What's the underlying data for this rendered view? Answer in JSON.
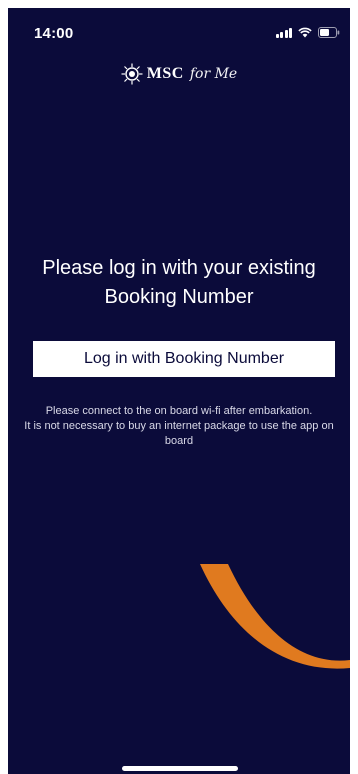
{
  "status_bar": {
    "time": "14:00",
    "icons": [
      "signal-icon",
      "wifi-icon",
      "battery-icon"
    ]
  },
  "logo": {
    "brand": "MSC",
    "tagline": "for Me",
    "emblem_icon": "compass-emblem-icon"
  },
  "login": {
    "headline": "Please log in with your existing Booking Number",
    "button_label": "Log in with Booking Number"
  },
  "info": {
    "line1": "Please connect to the on board wi-fi after embarkation.",
    "line2": "It is not necessary to buy an internet package to use the app on board"
  },
  "colors": {
    "background": "#0b0b3a",
    "accent": "#e07a1f",
    "button_bg": "#ffffff",
    "text": "#ffffff"
  }
}
